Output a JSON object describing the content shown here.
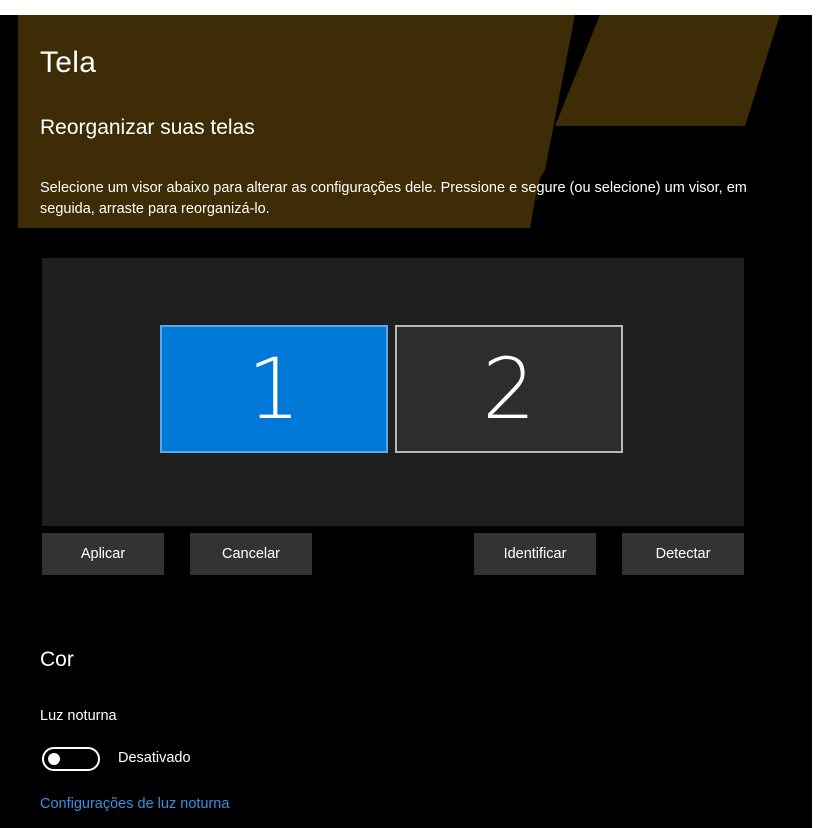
{
  "page": {
    "title": "Tela"
  },
  "arrange": {
    "heading": "Reorganizar suas telas",
    "description": "Selecione um visor abaixo para alterar as configurações dele. Pressione e segure (ou selecione) um visor, em seguida, arraste para reorganizá-lo.",
    "monitors": [
      {
        "label": "1",
        "selected": true
      },
      {
        "label": "2",
        "selected": false
      }
    ],
    "buttons": {
      "apply": "Aplicar",
      "cancel": "Cancelar",
      "identify": "Identificar",
      "detect": "Detectar"
    }
  },
  "color": {
    "heading": "Cor",
    "night_light_label": "Luz noturna",
    "night_light_state": "Desativado",
    "night_light_on": false,
    "settings_link": "Configurações de luz noturna"
  },
  "colors": {
    "background": "#000000",
    "accent": "#0078d7",
    "banner": "#3d2c05",
    "link": "#3a8fe0"
  }
}
